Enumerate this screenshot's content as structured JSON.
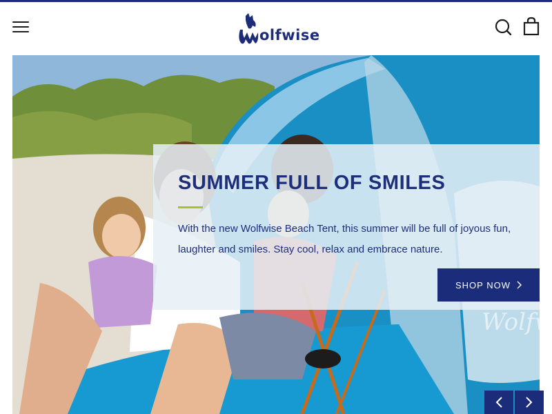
{
  "header": {
    "brand_name": "olfwise",
    "icons": [
      "menu-icon",
      "search-icon",
      "cart-icon"
    ]
  },
  "hero": {
    "title": "SUMMER FULL OF SMILES",
    "text": "With the new Wolfwise Beach Tent, this summer will be full of joyous fun, laughter and smiles. Stay cool, relax and embrace nature.",
    "cta_label": "SHOP NOW",
    "tent_brand_text": "Wolfw"
  },
  "slider": {
    "prev_icon": "chevron-left-icon",
    "next_icon": "chevron-right-icon"
  },
  "colors": {
    "brand_navy": "#1b2d7a",
    "accent_green": "#a6c032",
    "panel_bg": "#e7f0f6",
    "tent_blue": "#1a8fc4"
  }
}
